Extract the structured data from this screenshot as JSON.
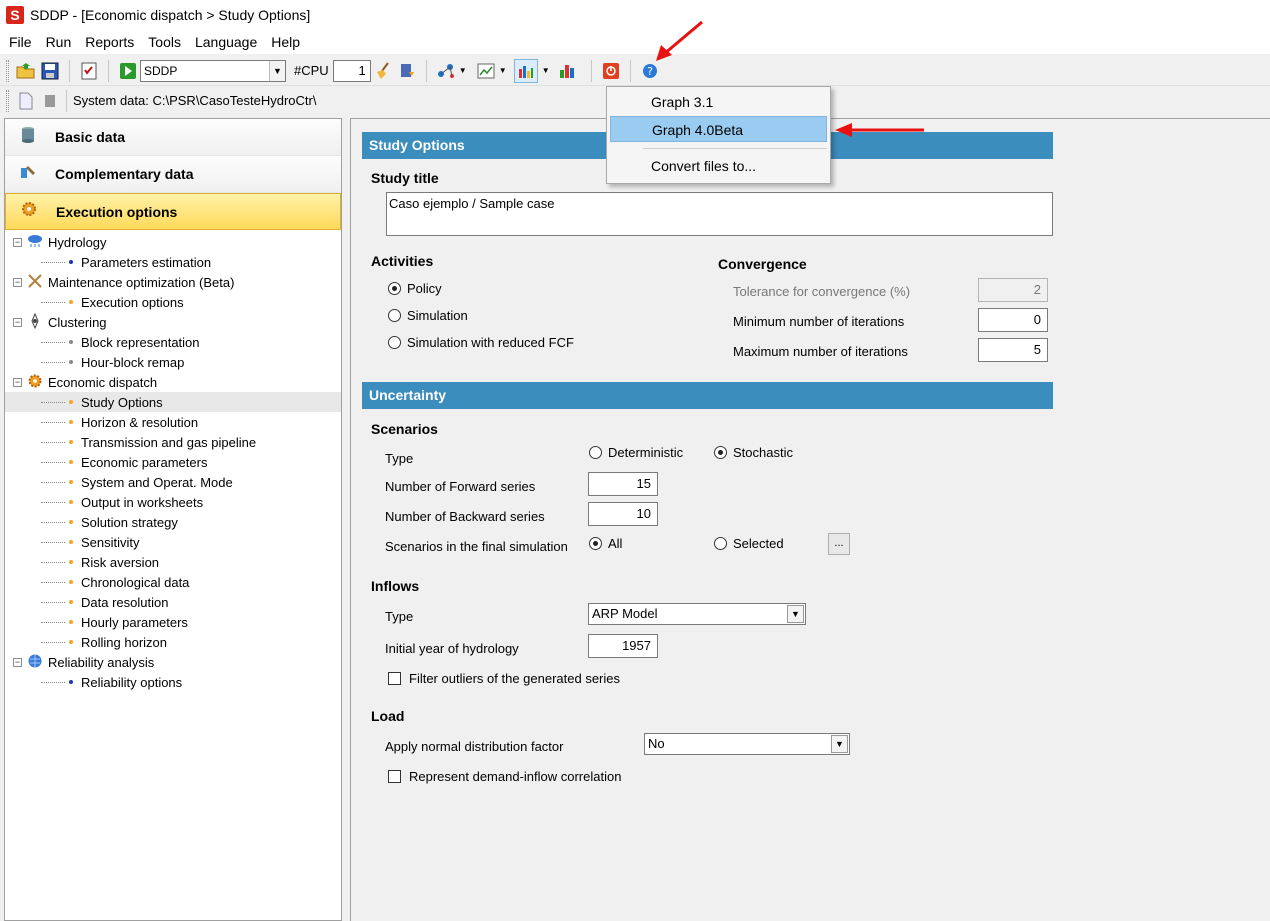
{
  "window": {
    "title": "SDDP - [Economic dispatch > Study Options]",
    "logo_letter": "S"
  },
  "menu": [
    "File",
    "Run",
    "Reports",
    "Tools",
    "Language",
    "Help"
  ],
  "toolbar": {
    "model_select": "SDDP",
    "cpu_label": "#CPU",
    "cpu_value": "1",
    "system_data": "System data: C:\\PSR\\CasoTesteHydroCtr\\"
  },
  "graph_menu": {
    "items": [
      "Graph 3.1",
      "Graph 4.0Beta",
      "Convert files to..."
    ],
    "highlighted": "Graph 4.0Beta"
  },
  "sidebar": {
    "sections": [
      "Basic data",
      "Complementary data",
      "Execution options"
    ],
    "active_section": "Execution options",
    "tree": [
      {
        "label": "Hydrology",
        "children": [
          {
            "label": "Parameters estimation"
          }
        ]
      },
      {
        "label": "Maintenance optimization (Beta)",
        "children": [
          {
            "label": "Execution options"
          }
        ]
      },
      {
        "label": "Clustering",
        "children": [
          {
            "label": "Block representation"
          },
          {
            "label": "Hour-block remap"
          }
        ]
      },
      {
        "label": "Economic dispatch",
        "children": [
          {
            "label": "Study Options"
          },
          {
            "label": "Horizon & resolution"
          },
          {
            "label": "Transmission and gas pipeline"
          },
          {
            "label": "Economic parameters"
          },
          {
            "label": "System and Operat. Mode"
          },
          {
            "label": "Output in worksheets"
          },
          {
            "label": "Solution strategy"
          },
          {
            "label": "Sensitivity"
          },
          {
            "label": "Risk aversion"
          },
          {
            "label": "Chronological data"
          },
          {
            "label": "Data resolution"
          },
          {
            "label": "Hourly parameters"
          },
          {
            "label": "Rolling horizon"
          }
        ]
      },
      {
        "label": "Reliability analysis",
        "children": [
          {
            "label": "Reliability options"
          }
        ]
      }
    ],
    "selected_item": "Study Options"
  },
  "study_options": {
    "banner": "Study Options",
    "study_title_label": "Study title",
    "study_title_value": "Caso ejemplo / Sample case",
    "activities_label": "Activities",
    "activities": [
      "Policy",
      "Simulation",
      "Simulation with reduced FCF"
    ],
    "activity_selected": "Policy",
    "convergence_label": "Convergence",
    "tolerance_label": "Tolerance for convergence (%)",
    "tolerance_value": "2",
    "min_iter_label": "Minimum number of iterations",
    "min_iter_value": "0",
    "max_iter_label": "Maximum number of iterations",
    "max_iter_value": "5"
  },
  "uncertainty": {
    "banner": "Uncertainty",
    "scenarios_label": "Scenarios",
    "type_label": "Type",
    "type_options": [
      "Deterministic",
      "Stochastic"
    ],
    "type_selected": "Stochastic",
    "forward_label": "Number of Forward series",
    "forward_value": "15",
    "backward_label": "Number of Backward series",
    "backward_value": "10",
    "final_sim_label": "Scenarios in the final simulation",
    "final_sim_options": [
      "All",
      "Selected"
    ],
    "final_sim_selected": "All",
    "ellipsis": "...",
    "inflows_label": "Inflows",
    "inflow_type_label": "Type",
    "inflow_type_value": "ARP Model",
    "initial_year_label": "Initial year of hydrology",
    "initial_year_value": "1957",
    "filter_outliers_label": "Filter outliers of the generated series",
    "load_label": "Load",
    "normal_dist_label": "Apply normal distribution factor",
    "normal_dist_value": "No",
    "demand_corr_label": "Represent demand-inflow correlation"
  },
  "colors": {
    "banner": "#3b8dbd",
    "active_section": "#ffd95a",
    "menu_highlight": "#99ccf0",
    "annotation_arrow": "#e81010"
  }
}
